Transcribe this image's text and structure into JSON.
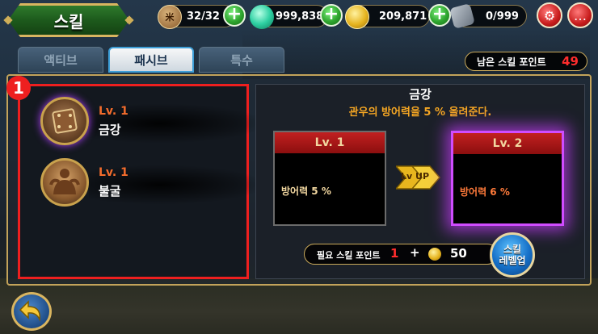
{
  "header": {
    "title": "스킬",
    "resources": [
      {
        "icon": "stamina-bag-icon",
        "value": "32/32"
      },
      {
        "icon": "jade-orb-icon",
        "value": "999,838"
      },
      {
        "icon": "gold-coin-icon",
        "value": "209,871"
      },
      {
        "icon": "crate-icon",
        "value": "0/999"
      }
    ]
  },
  "tabs": [
    {
      "label": "액티브",
      "active": false
    },
    {
      "label": "패시브",
      "active": true
    },
    {
      "label": "특수",
      "active": false
    }
  ],
  "remaining_points": {
    "label": "남은 스킬 포인트",
    "value": "49"
  },
  "callout": {
    "number": "1"
  },
  "skills": [
    {
      "level": "Lv. 1",
      "name": "금강",
      "icon": "armor-shield-icon"
    },
    {
      "level": "Lv. 1",
      "name": "불굴",
      "icon": "muscle-warrior-icon"
    }
  ],
  "detail": {
    "title": "금강",
    "description": "관우의 방어력을 5 % 올려준다.",
    "current": {
      "level": "Lv. 1",
      "stat": "방어력 5 %"
    },
    "next": {
      "level": "Lv. 2",
      "stat": "방어력 6 %"
    },
    "arrow_label": "Lv UP",
    "cost": {
      "label": "필요 스킬 포인트",
      "points": "1",
      "plus": "+",
      "gold": "50"
    },
    "levelup_button": {
      "line1": "스킬",
      "line2": "레벨업"
    }
  },
  "colors": {
    "accent_red": "#ee1f1f",
    "gold_border": "#c3a35a",
    "skill_level": "#f46c2c",
    "description": "#f5a623",
    "next_glow": "#d04cff"
  }
}
